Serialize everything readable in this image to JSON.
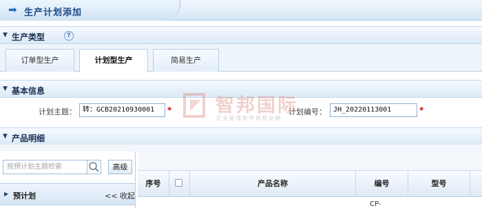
{
  "page": {
    "title": "生产计划添加"
  },
  "sections": {
    "production_type": "生产类型",
    "basic_info": "基本信息",
    "product_detail": "产品明细"
  },
  "tabs": [
    {
      "label": "订单型生产",
      "active": false
    },
    {
      "label": "计划型生产",
      "active": true
    },
    {
      "label": "简易生产",
      "active": false
    }
  ],
  "form": {
    "plan_subject_label": "计划主题：",
    "plan_subject_value": "转：GCB20210930001",
    "plan_number_label": "计划编号：",
    "plan_number_value": "JH_20220113001",
    "required_mark": "*"
  },
  "watermark": {
    "brand": "智邦国际",
    "tagline": "企业管理软件领导品牌"
  },
  "left_panel": {
    "search_placeholder": "按预计划主题检索",
    "advanced_label": "高级",
    "plan_title": "预计划",
    "collapse_label": "<< 收起"
  },
  "grid": {
    "columns": [
      "序号",
      "",
      "产品名称",
      "编号",
      "型号"
    ],
    "first_row_code": "CP-"
  },
  "icons": {
    "title": "arrow-right-icon",
    "help": "help-icon",
    "search": "search-icon",
    "expand": "triangle-down-icon"
  },
  "colors": {
    "accent": "#1c4a86",
    "required": "#e00000",
    "border": "#b6cce3"
  }
}
